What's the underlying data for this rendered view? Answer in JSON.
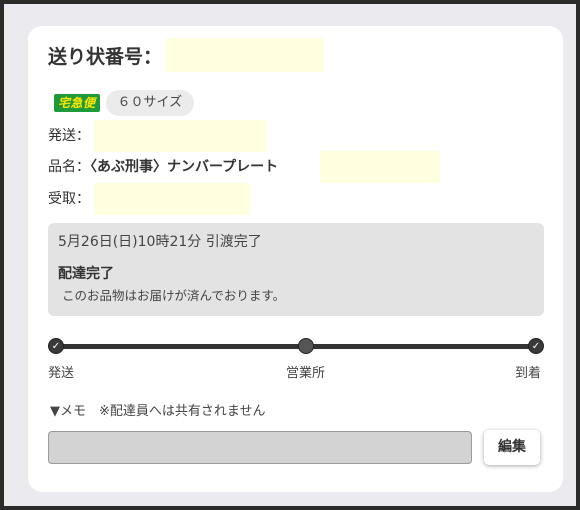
{
  "header": {
    "title": "送り状番号："
  },
  "service": {
    "logo_text": "宅急便",
    "size": "６０サイズ"
  },
  "fields": {
    "sender_label": "発送：",
    "item_label": "品名：",
    "item_name": "〈あぶ刑事〉ナンバープレート",
    "receiver_label": "受取："
  },
  "status": {
    "timestamp": "5月26日(日)10時21分 引渡完了",
    "title": "配達完了",
    "description": "このお品物はお届けが済んでおります。"
  },
  "progress": {
    "stops": [
      {
        "label": "発送",
        "state": "done",
        "mark": "✓"
      },
      {
        "label": "営業所",
        "state": "passed",
        "mark": ""
      },
      {
        "label": "到着",
        "state": "done",
        "mark": "✓"
      }
    ]
  },
  "memo": {
    "label": "▼メモ　※配達員へは共有されません",
    "value": "",
    "edit_label": "編集"
  },
  "colors": {
    "logo_bg": "#1f9a3a",
    "logo_text": "#ffe600",
    "redaction": "#ffffe0"
  }
}
